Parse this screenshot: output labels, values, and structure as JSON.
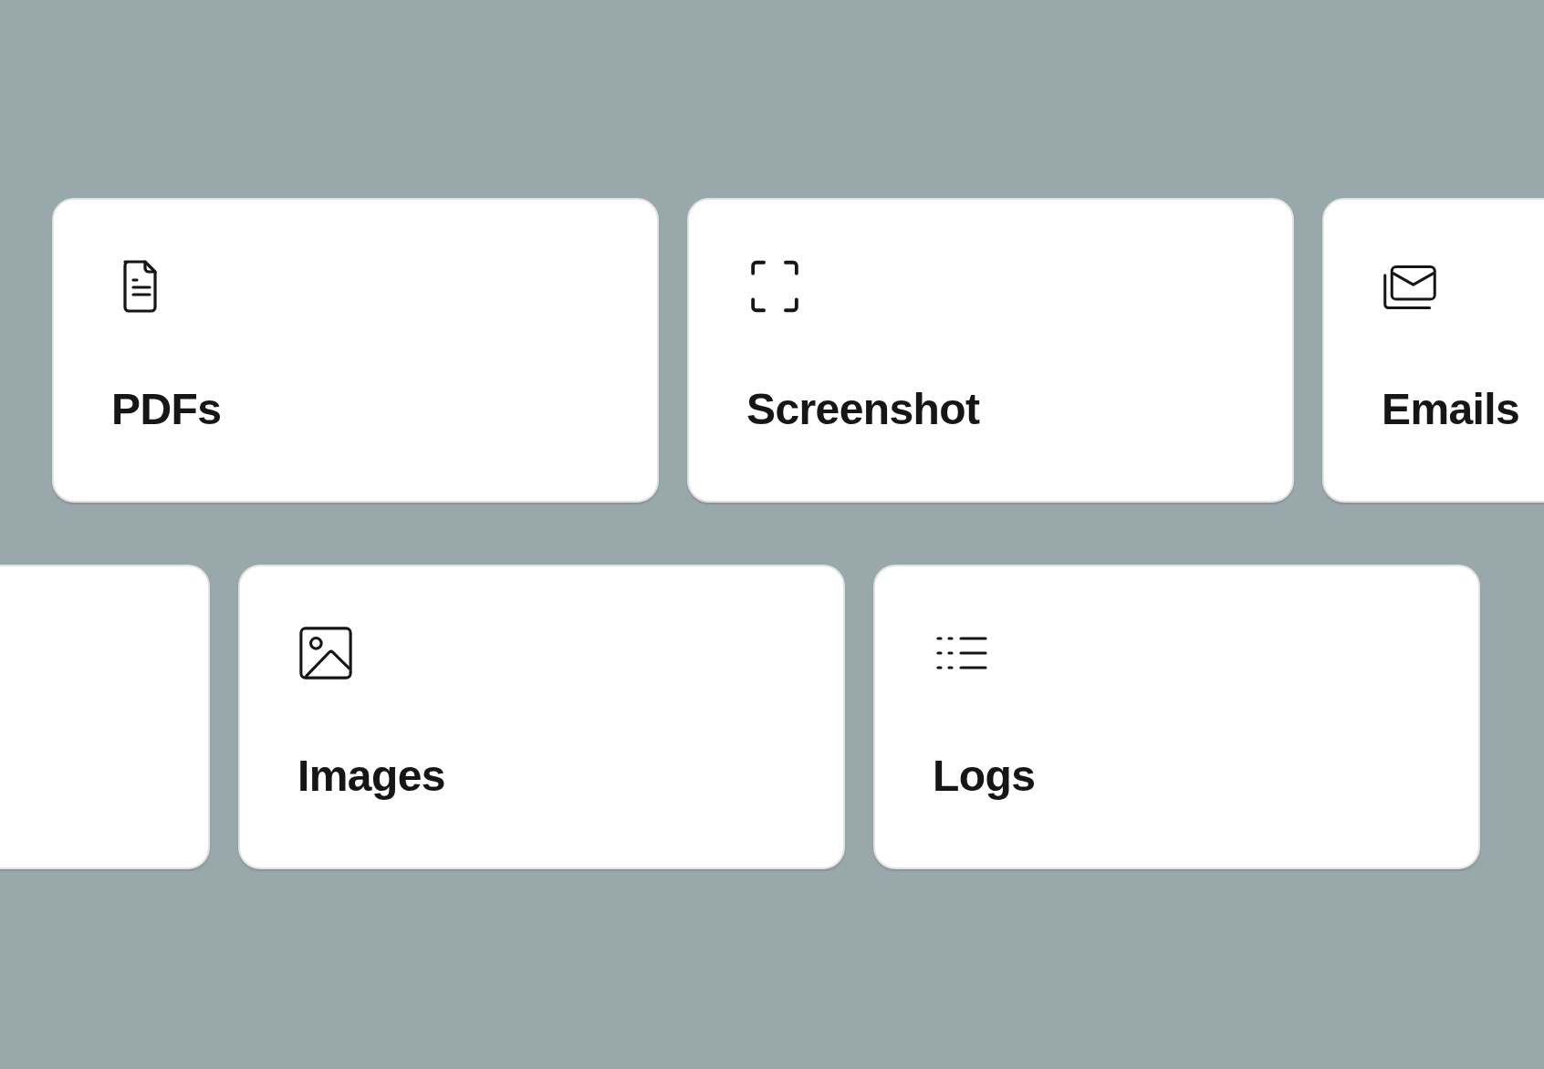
{
  "rows": [
    {
      "cards": [
        {
          "kind": "tile",
          "label": "PDFs"
        },
        {
          "kind": "tile",
          "label": "Screenshot"
        },
        {
          "kind": "tile",
          "label": "Emails"
        }
      ]
    },
    {
      "cards": [
        {
          "kind": "blank"
        },
        {
          "kind": "tile",
          "label": "Images"
        },
        {
          "kind": "tile",
          "label": "Logs"
        }
      ]
    }
  ]
}
